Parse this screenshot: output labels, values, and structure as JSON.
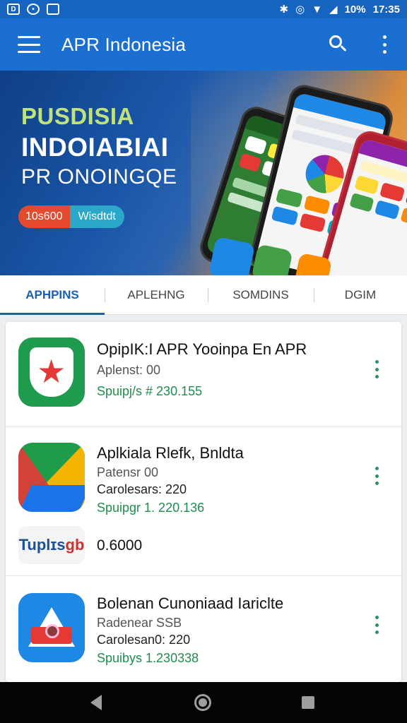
{
  "status_bar": {
    "battery_text": "10%",
    "time": "17:35"
  },
  "app_bar": {
    "title": "APR Indonesia"
  },
  "banner": {
    "line1": "PUSDISIA",
    "line2": "INDOIABIAI",
    "line3": "PR ONOINGQE",
    "pill_left": "10s600",
    "pill_right": "Wisdtdt"
  },
  "tabs": [
    {
      "label": "APHPINS",
      "active": true
    },
    {
      "label": "APLEHNG",
      "active": false
    },
    {
      "label": "SOMDINS",
      "active": false
    },
    {
      "label": "DGIM",
      "active": false
    }
  ],
  "apps": [
    {
      "title": "OpipIK:I APR Yooinpa En APR",
      "subtitle": "Aplenst: 00",
      "green": "Spuipj/s # 230.155",
      "icon": "shield-star-icon"
    },
    {
      "title": "Aplkiala Rlefk, Bnldta",
      "subtitle": "Patensr 00",
      "subtitle2": "Carolesars: 220",
      "green": "Spuipgr 1. 220.136",
      "icon": "colorful-triangle-icon"
    },
    {
      "title": "Bolenan Cunoniaad Iariclte",
      "subtitle": "Radenear SSB",
      "subtitle2": "Carolesan0: 220",
      "green": "Spuibys 1.230338",
      "icon": "red-triangle-icon"
    }
  ],
  "promo_row": {
    "logo_text": "Tuplɪs",
    "logo_mark": "gb",
    "value": "0.6000"
  },
  "colors": {
    "primary": "#1a6fd0",
    "status": "#1565c0",
    "accent_green": "#1e8e4e",
    "tab_active": "#1a5fb4"
  }
}
